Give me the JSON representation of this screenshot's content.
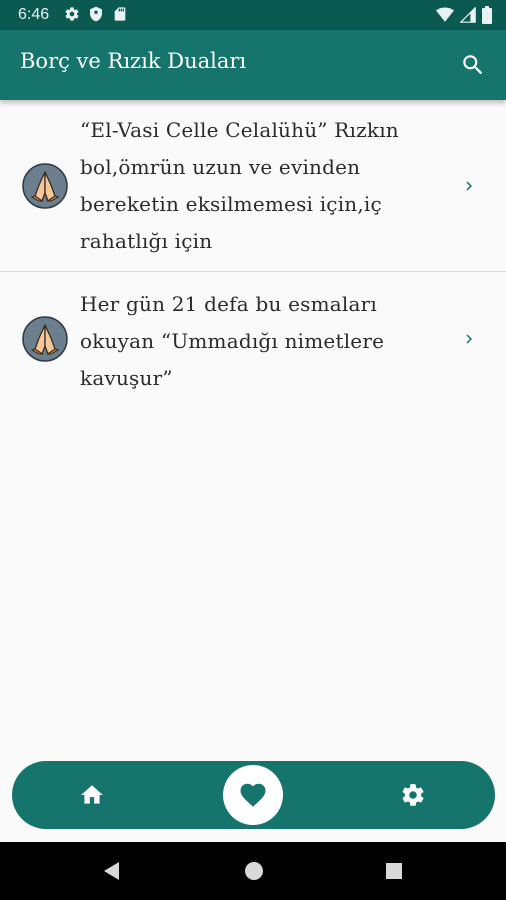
{
  "status_bar": {
    "time": "6:46",
    "left_icons": [
      "gear-icon",
      "shield-icon",
      "sd-card-icon"
    ],
    "right_icons": [
      "wifi-icon",
      "signal-icon",
      "battery-icon"
    ]
  },
  "app_bar": {
    "title": "Borç ve Rızık Duaları",
    "search_icon": "search-icon"
  },
  "list": {
    "items": [
      {
        "lines": [
          "“El-Vasi Celle Celalühü” Rızkın",
          "bol,ömrün uzun ve evinden",
          "bereketin eksilmemesi için,iç",
          "rahatlığı için"
        ],
        "icon": "praying-hands-icon",
        "chevron": "chevron-right-icon"
      },
      {
        "lines": [
          "Her gün 21 defa bu esmaları",
          "okuyan “Ummadığı nimetlere",
          "kavuşur”"
        ],
        "icon": "praying-hands-icon",
        "chevron": "chevron-right-icon"
      }
    ]
  },
  "bottom_nav": {
    "items": [
      {
        "icon": "home-icon",
        "active": false
      },
      {
        "icon": "heart-icon",
        "active": true
      },
      {
        "icon": "gear-icon",
        "active": false
      }
    ]
  },
  "system_nav": {
    "buttons": [
      "back-triangle-icon",
      "home-circle-icon",
      "recents-square-icon"
    ]
  },
  "colors": {
    "status_bar": "#0b5a52",
    "primary": "#15756c",
    "background": "#fafafa",
    "text": "#2b2b2b"
  }
}
